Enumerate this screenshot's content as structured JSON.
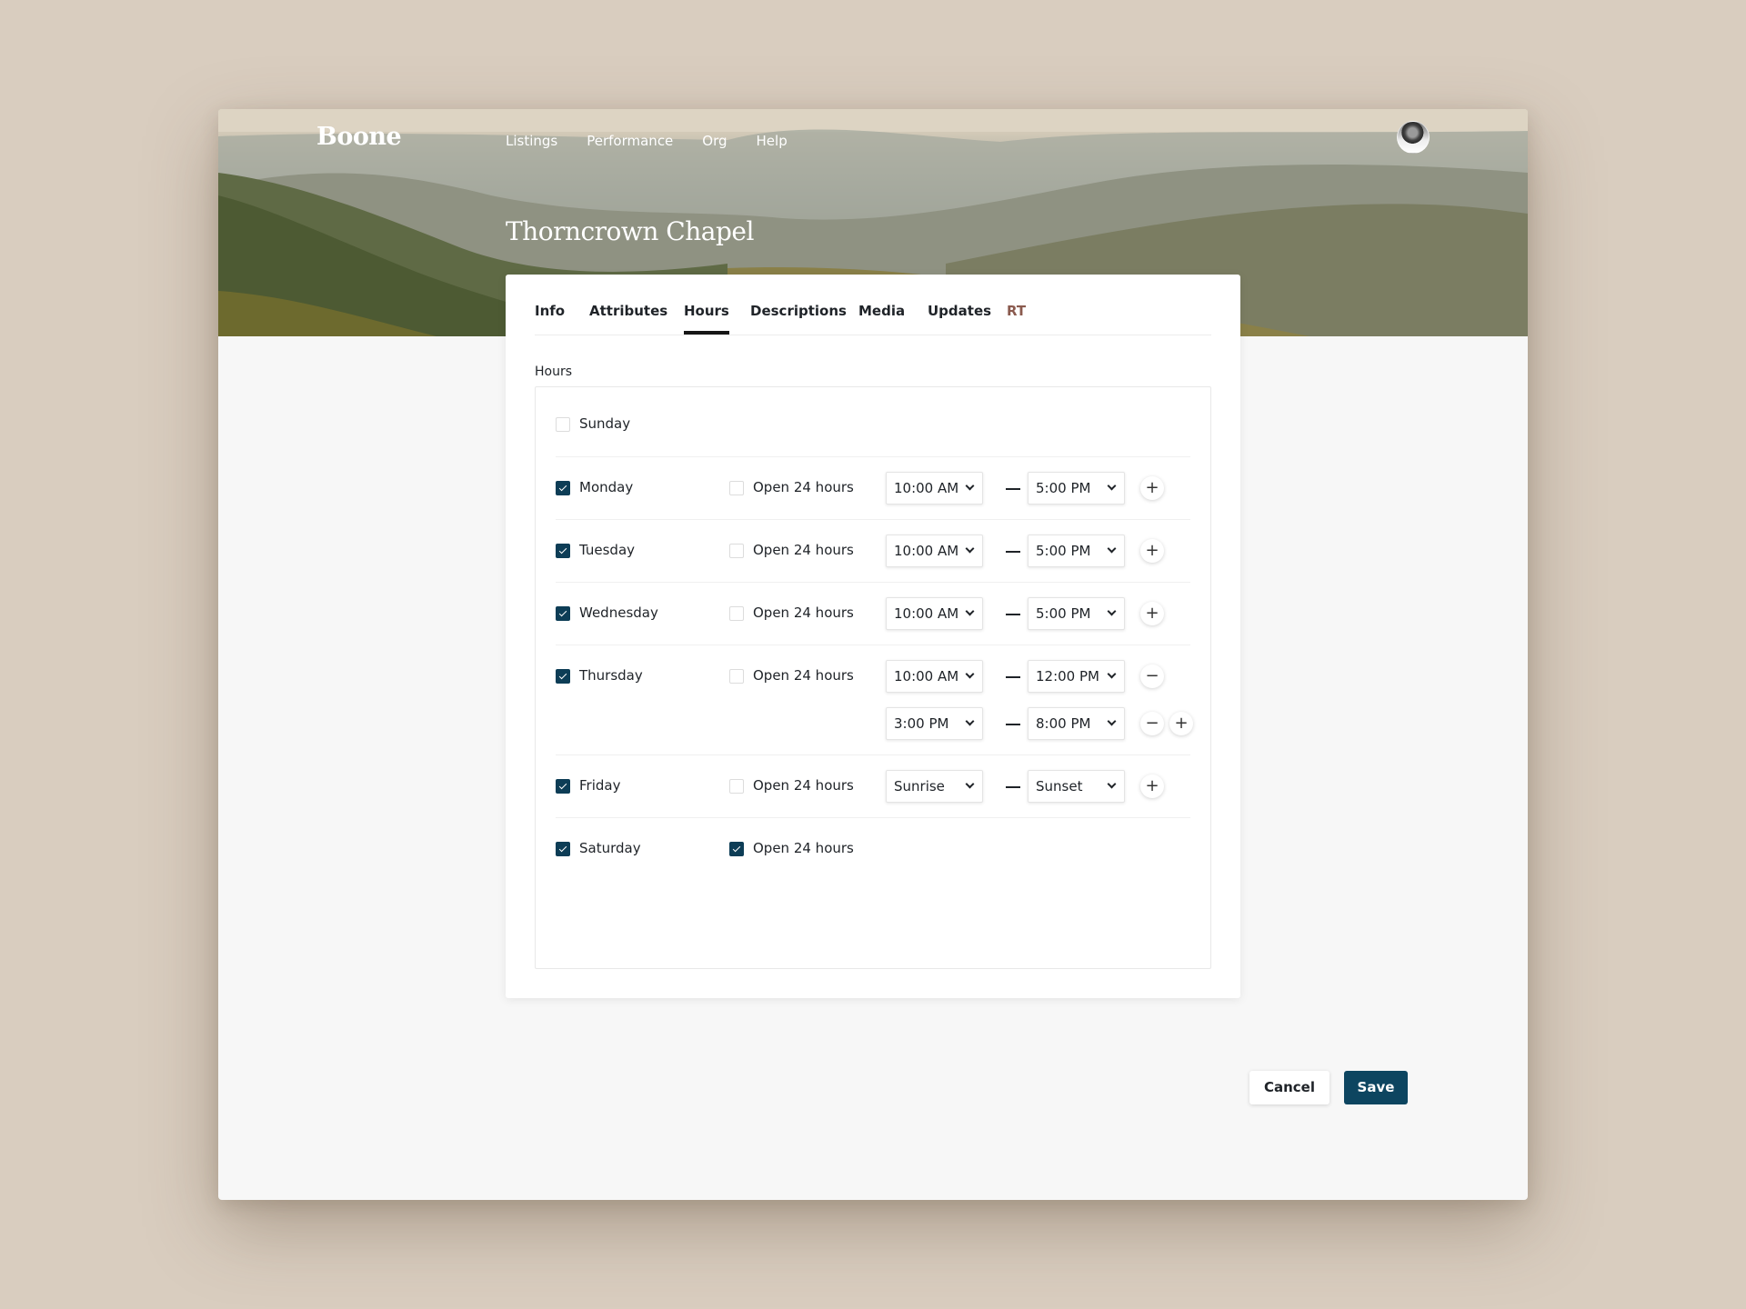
{
  "header": {
    "brand": "Boone",
    "nav": [
      "Listings",
      "Performance",
      "Org",
      "Help"
    ],
    "title": "Thorncrown Chapel"
  },
  "tabs": [
    {
      "label": "Info",
      "active": false
    },
    {
      "label": "Attributes",
      "active": false
    },
    {
      "label": "Hours",
      "active": true
    },
    {
      "label": "Descriptions",
      "active": false
    },
    {
      "label": "Media",
      "active": false
    },
    {
      "label": "Updates",
      "active": false
    },
    {
      "label": "RT",
      "active": false
    }
  ],
  "hours": {
    "section_label": "Hours",
    "open24_label": "Open 24 hours",
    "days": [
      {
        "name": "Sunday",
        "enabled": false,
        "open24": null,
        "ranges": []
      },
      {
        "name": "Monday",
        "enabled": true,
        "open24": false,
        "ranges": [
          {
            "start": "10:00 AM",
            "end": "5:00 PM"
          }
        ]
      },
      {
        "name": "Tuesday",
        "enabled": true,
        "open24": false,
        "ranges": [
          {
            "start": "10:00 AM",
            "end": "5:00 PM"
          }
        ]
      },
      {
        "name": "Wednesday",
        "enabled": true,
        "open24": false,
        "ranges": [
          {
            "start": "10:00 AM",
            "end": "5:00 PM"
          }
        ]
      },
      {
        "name": "Thursday",
        "enabled": true,
        "open24": false,
        "ranges": [
          {
            "start": "10:00 AM",
            "end": "12:00 PM"
          },
          {
            "start": "3:00 PM",
            "end": "8:00 PM"
          }
        ]
      },
      {
        "name": "Friday",
        "enabled": true,
        "open24": false,
        "ranges": [
          {
            "start": "Sunrise",
            "end": "Sunset"
          }
        ]
      },
      {
        "name": "Saturday",
        "enabled": true,
        "open24": true,
        "ranges": []
      }
    ],
    "add_symbol": "+",
    "remove_symbol": "−"
  },
  "actions": {
    "cancel": "Cancel",
    "save": "Save"
  },
  "colors": {
    "accent": "#0d3d56",
    "save_button": "#0d4560",
    "rt_tab": "#8a5a4e"
  }
}
